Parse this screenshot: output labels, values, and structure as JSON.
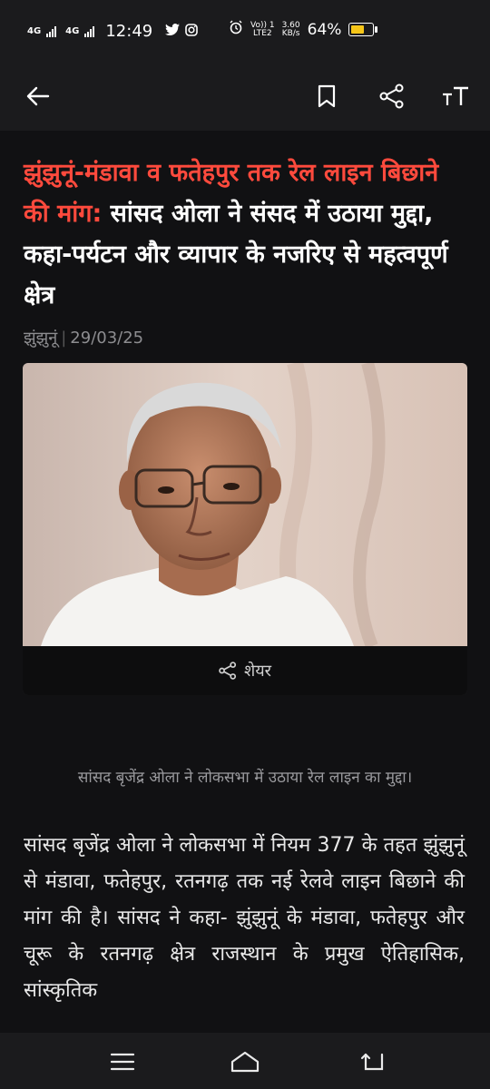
{
  "status_bar": {
    "net1": "4G",
    "net2": "4G",
    "time": "12:49",
    "volte": "VoLTE 1 LTE2",
    "volte_top": "Vo)) 1",
    "volte_bottom": "LTE2",
    "speed_top": "3.60",
    "speed_bottom": "KB/s",
    "battery": "64%",
    "battery_level": 0.64,
    "battery_color": "#f5c518"
  },
  "toolbar": {
    "icons": [
      "back-arrow-icon",
      "bookmark-icon",
      "share-icon",
      "text-size-icon"
    ]
  },
  "article": {
    "headline_highlight": "झुंझुनूं-मंडावा व फतेहपुर तक रेल लाइन बिछाने की मांग:",
    "headline_rest": " सांसद ओला ने संसद में उठाया मुद्दा, कहा-पर्यटन और व्यापार के नजरिए से महत्वपूर्ण क्षेत्र",
    "location": "झुंझुनूं",
    "date": "29/03/25",
    "share_label": "शेयर",
    "caption": "सांसद बृजेंद्र ओला ने लोकसभा में उठाया रेल लाइन का मुद्दा।",
    "body": "सांसद बृजेंद्र ओला ने लोकसभा में नियम 377 के तहत झुंझुनूं से मंडावा, फतेहपुर, रतनगढ़ तक नई रेलवे लाइन बिछाने की मांग की है। सांसद ने कहा- झुंझुनूं के मंडावा, फतेहपुर और चूरू के रतनगढ़ क्षेत्र राजस्थान के प्रमुख ऐतिहासिक, सांस्कृतिक"
  },
  "colors": {
    "highlight": "#ff4a3d",
    "background": "#111113"
  },
  "nav": {
    "icons": [
      "menu-icon",
      "home-icon",
      "back-icon"
    ]
  }
}
